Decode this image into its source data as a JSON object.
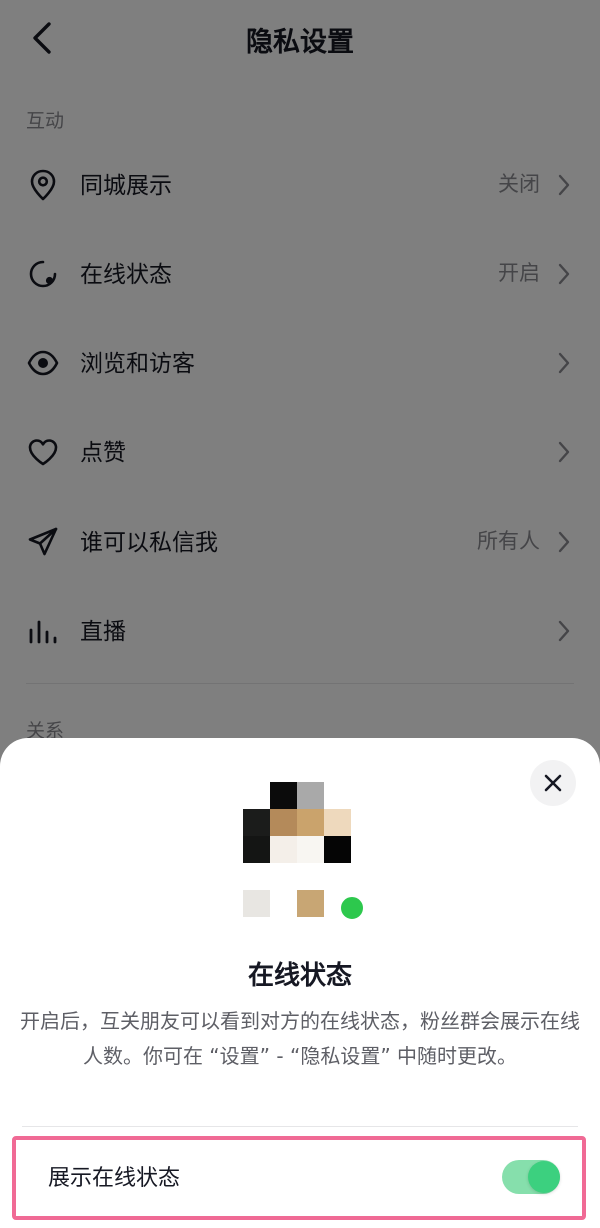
{
  "nav": {
    "title": "隐私设置"
  },
  "sections": {
    "interaction": "互动",
    "relationship": "关系"
  },
  "rows": [
    {
      "label": "同城展示",
      "value": "关闭",
      "icon": "location-pin-icon"
    },
    {
      "label": "在线状态",
      "value": "开启",
      "icon": "online-status-icon"
    },
    {
      "label": "浏览和访客",
      "value": "",
      "icon": "eye-icon"
    },
    {
      "label": "点赞",
      "value": "",
      "icon": "heart-icon"
    },
    {
      "label": "谁可以私信我",
      "value": "所有人",
      "icon": "paper-plane-icon"
    },
    {
      "label": "直播",
      "value": "",
      "icon": "bar-chart-icon"
    }
  ],
  "sheet": {
    "title": "在线状态",
    "description": "开启后，互关朋友可以看到对方的在线状态，粉丝群会展示在线人数。你可在 “设置” - “隐私设置” 中随时更改。",
    "toggle_label": "展示在线状态",
    "toggle_on": true
  },
  "colors": {
    "accent_green": "#3cd07f",
    "online_dot": "#2dc84d",
    "highlight_border": "#f06a95"
  }
}
